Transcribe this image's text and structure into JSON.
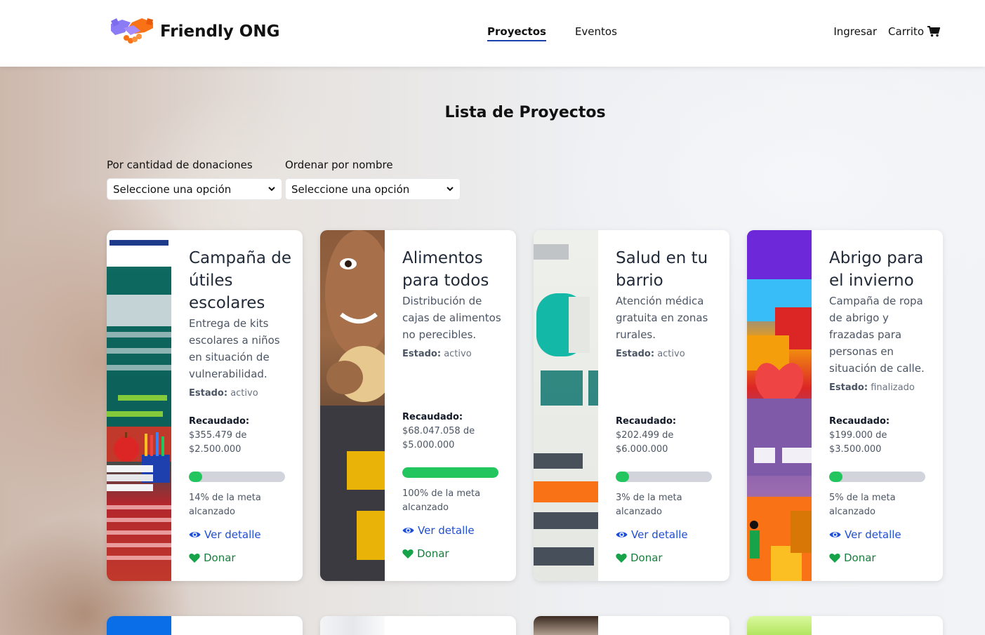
{
  "brand": {
    "name": "Friendly ONG"
  },
  "nav": {
    "items": [
      "Proyectos",
      "Eventos"
    ],
    "active": "Proyectos"
  },
  "auth": {
    "login": "Ingresar",
    "cart": "Carrito"
  },
  "page": {
    "title": "Lista de Proyectos"
  },
  "filters": {
    "donations": {
      "label": "Por cantidad de donaciones",
      "value": "Seleccione una opción"
    },
    "name": {
      "label": "Ordenar por nombre",
      "value": "Seleccione una opción"
    }
  },
  "common": {
    "estado_label": "Estado:",
    "raised_label": "Recaudado:",
    "of": "de",
    "view": "Ver detalle",
    "donate": "Donar"
  },
  "projects": [
    {
      "title": "Campaña de útiles escolares",
      "description": "Entrega de kits escolares a niños en situación de vulnerabilidad.",
      "status": "activo",
      "raised": "$355.479",
      "goal": "$2.500.000",
      "progress": 14,
      "progress_text": "14% de la meta alcanzado"
    },
    {
      "title": "Alimentos para todos",
      "description": "Distribución de cajas de alimentos no perecibles.",
      "status": "activo",
      "raised": "$68.047.058",
      "goal": "$5.000.000",
      "progress": 100,
      "progress_text": "100% de la meta alcanzado"
    },
    {
      "title": "Salud en tu barrio",
      "description": "Atención médica gratuita en zonas rurales.",
      "status": "activo",
      "raised": "$202.499",
      "goal": "$6.000.000",
      "progress": 3,
      "progress_text": "3% de la meta alcanzado"
    },
    {
      "title": "Abrigo para el invierno",
      "description": "Campaña de ropa de abrigo y frazadas para personas en situación de calle.",
      "status": "finalizado",
      "raised": "$199.000",
      "goal": "$3.500.000",
      "progress": 5,
      "progress_text": "5% de la meta alcanzado"
    }
  ],
  "colors": {
    "accent": "#1d4ed8",
    "donate": "#15803d",
    "progress": "#22c55e"
  }
}
